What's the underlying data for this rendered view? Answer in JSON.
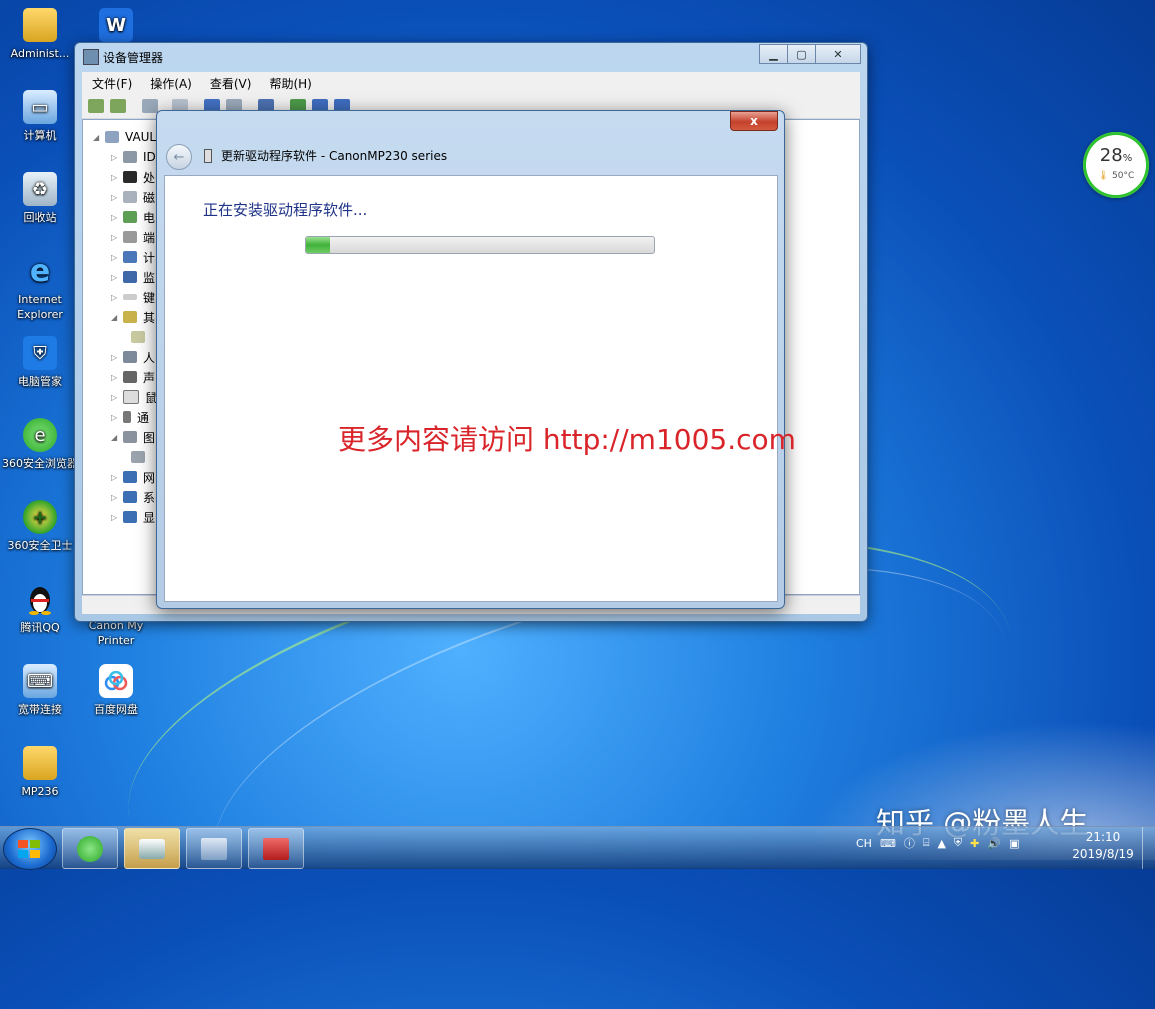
{
  "desktop": {
    "icons": [
      {
        "label": "Administ..."
      },
      {
        "label": ""
      },
      {
        "label": "计算机"
      },
      {
        "label": "回收站"
      },
      {
        "label": "Internet Explorer"
      },
      {
        "label": "电脑管家"
      },
      {
        "label": "360安全浏览器"
      },
      {
        "label": "360安全卫士"
      },
      {
        "label": "腾讯QQ"
      },
      {
        "label": "Canon My Printer"
      },
      {
        "label": "宽带连接"
      },
      {
        "label": "百度网盘"
      },
      {
        "label": "MP236"
      }
    ]
  },
  "device_manager": {
    "title": "设备管理器",
    "menu": [
      "文件(F)",
      "操作(A)",
      "查看(V)",
      "帮助(H)"
    ],
    "tree": {
      "root": "VAUL",
      "items": [
        "ID",
        "处",
        "磁",
        "电",
        "端",
        "计",
        "监",
        "键",
        "其",
        "",
        "人",
        "声",
        "鼠",
        "通",
        "图",
        "",
        "网",
        "系",
        "显"
      ]
    }
  },
  "dialog": {
    "title": "更新驱动程序软件 - CanonMP230 series",
    "status": "正在安装驱动程序软件...",
    "progress": 0.07,
    "close_label": "x"
  },
  "watermark": "更多内容请访问 http://m1005.com",
  "gadget": {
    "percent": "28",
    "percent_unit": "%",
    "temp": "50°C"
  },
  "taskbar": {
    "lang": "CH",
    "clock_time": "21:10",
    "clock_date": "2019/8/19"
  },
  "zhihu_watermark": "知乎 @粉墨人生",
  "colors": {
    "progress": "#3fb13a",
    "watermark": "#d9252a",
    "heading": "#1e3287"
  }
}
